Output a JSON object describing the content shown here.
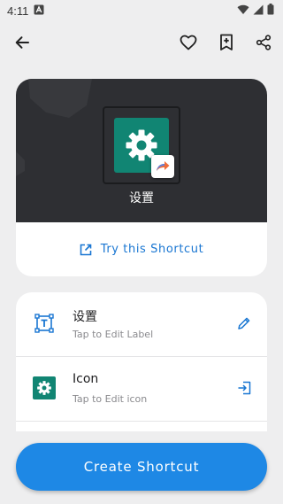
{
  "status_bar": {
    "time": "4:11",
    "notification_icon": "a-box-icon",
    "icons": [
      "wifi-icon",
      "signal-icon",
      "battery-icon"
    ]
  },
  "app_bar": {
    "back_icon": "arrow-back-icon",
    "actions": [
      "heart-outline-icon",
      "bookmark-add-icon",
      "share-icon"
    ]
  },
  "preview": {
    "app_label": "设置",
    "app_icon": "gear-icon",
    "badge_icon": "shortcut-arrow-icon",
    "try_label": "Try this Shortcut",
    "try_icon": "open-in-new-icon"
  },
  "settings": {
    "label_row": {
      "title": "设置",
      "subtitle": "Tap to Edit Label",
      "icon": "text-box-icon",
      "action_icon": "pencil-icon"
    },
    "icon_row": {
      "title": "Icon",
      "subtitle": "Tap to Edit icon",
      "icon": "gear-icon",
      "action_icon": "login-arrow-icon"
    }
  },
  "create_button": {
    "label": "Create Shortcut"
  },
  "colors": {
    "accent": "#1e88e5",
    "link": "#1976d2",
    "app_icon_bg": "#118573",
    "preview_bg": "#2e2f33",
    "page_bg": "#eeeeef"
  }
}
